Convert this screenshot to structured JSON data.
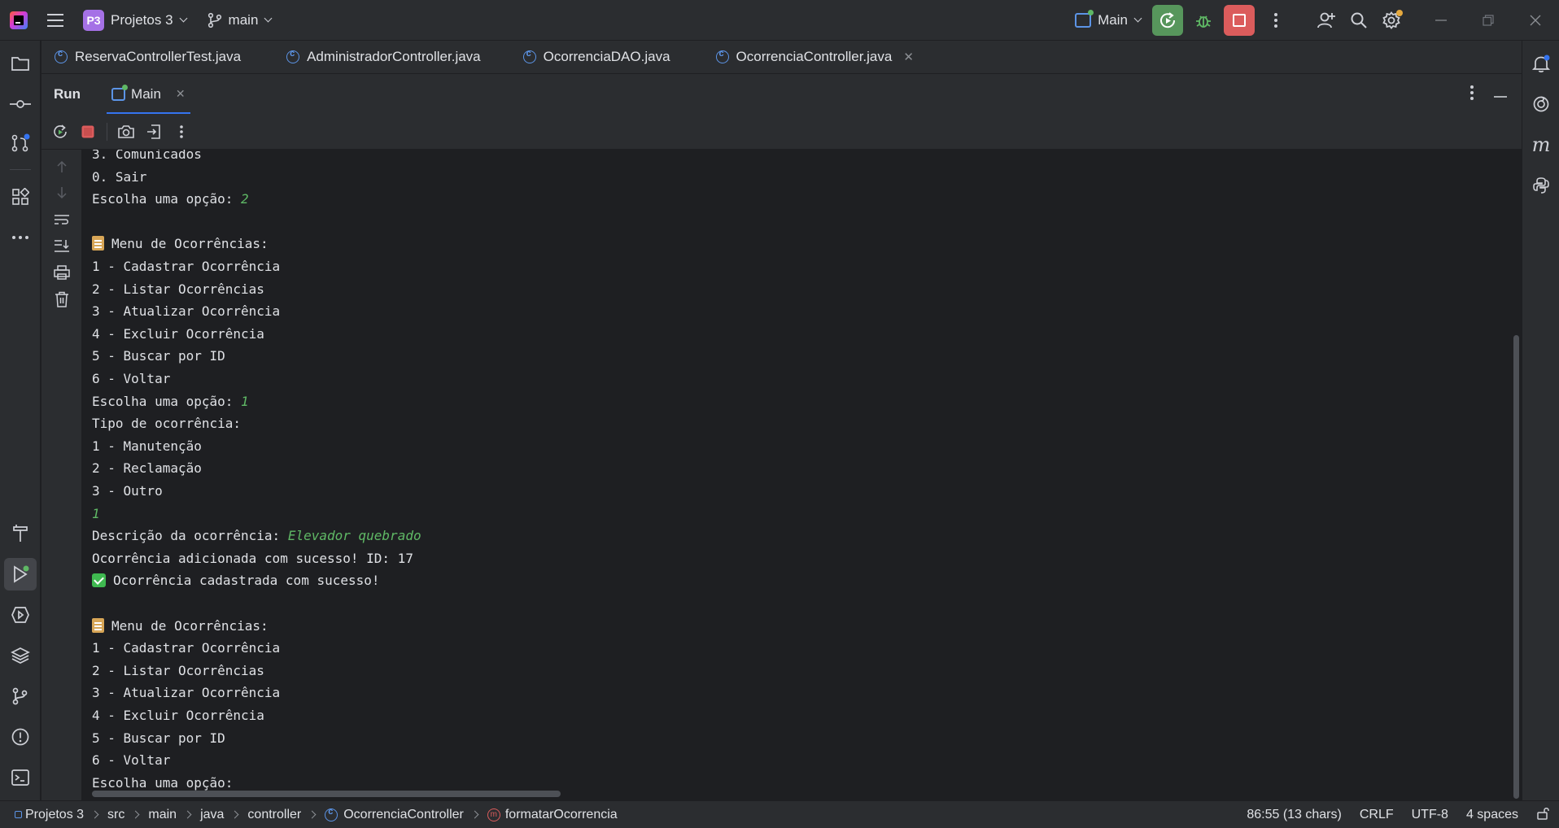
{
  "titlebar": {
    "project_badge": "P3",
    "project_name": "Projetos 3",
    "branch": "main",
    "run_config": "Main"
  },
  "editor_tabs": [
    {
      "label": "ReservaControllerTest.java"
    },
    {
      "label": "AdministradorController.java"
    },
    {
      "label": "OcorrenciaDAO.java"
    },
    {
      "label": "OcorrenciaController.java",
      "active": true
    }
  ],
  "run_panel": {
    "title": "Run",
    "tab_label": "Main"
  },
  "console": {
    "lines": [
      {
        "text": "3. Comunicados"
      },
      {
        "text": "0. Sair"
      },
      {
        "text": "Escolha uma opção: ",
        "input": "2"
      },
      {
        "text": ""
      },
      {
        "text": "Menu de Ocorrências:",
        "emoji": "clipboard"
      },
      {
        "text": "1 - Cadastrar Ocorrência"
      },
      {
        "text": "2 - Listar Ocorrências"
      },
      {
        "text": "3 - Atualizar Ocorrência"
      },
      {
        "text": "4 - Excluir Ocorrência"
      },
      {
        "text": "5 - Buscar por ID"
      },
      {
        "text": "6 - Voltar"
      },
      {
        "text": "Escolha uma opção: ",
        "input": "1"
      },
      {
        "text": "Tipo de ocorrência:"
      },
      {
        "text": "1 - Manutenção"
      },
      {
        "text": "2 - Reclamação"
      },
      {
        "text": "3 - Outro"
      },
      {
        "text": "",
        "input": "1"
      },
      {
        "text": "Descrição da ocorrência: ",
        "input": "Elevador quebrado"
      },
      {
        "text": "Ocorrência adicionada com sucesso! ID: 17"
      },
      {
        "text": "Ocorrência cadastrada com sucesso!",
        "emoji": "check"
      },
      {
        "text": ""
      },
      {
        "text": "Menu de Ocorrências:",
        "emoji": "clipboard"
      },
      {
        "text": "1 - Cadastrar Ocorrência"
      },
      {
        "text": "2 - Listar Ocorrências"
      },
      {
        "text": "3 - Atualizar Ocorrência"
      },
      {
        "text": "4 - Excluir Ocorrência"
      },
      {
        "text": "5 - Buscar por ID"
      },
      {
        "text": "6 - Voltar"
      },
      {
        "text": "Escolha uma opção:"
      }
    ]
  },
  "statusbar": {
    "breadcrumbs": [
      {
        "label": "Projetos 3",
        "icon": "project-icon"
      },
      {
        "label": "src"
      },
      {
        "label": "main"
      },
      {
        "label": "java"
      },
      {
        "label": "controller"
      },
      {
        "label": "OcorrenciaController",
        "icon": "class-icon"
      },
      {
        "label": "formatarOcorrencia",
        "icon": "method-icon"
      }
    ],
    "position": "86:55 (13 chars)",
    "line_ending": "CRLF",
    "encoding": "UTF-8",
    "indent": "4 spaces"
  },
  "colors": {
    "accent": "#3574f0",
    "run_green": "#57965c",
    "stop_red": "#db5c5c",
    "input_green": "#5fb865"
  }
}
